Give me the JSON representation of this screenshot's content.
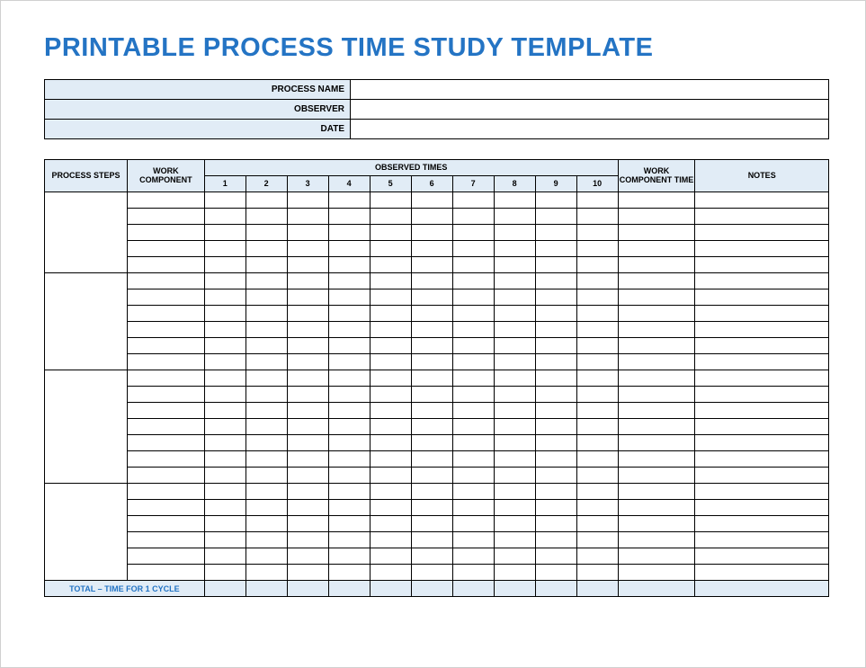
{
  "title": "PRINTABLE PROCESS TIME STUDY TEMPLATE",
  "info": {
    "process_name_label": "PROCESS NAME",
    "process_name_value": "",
    "observer_label": "OBSERVER",
    "observer_value": "",
    "date_label": "DATE",
    "date_value": ""
  },
  "columns": {
    "steps": "PROCESS STEPS",
    "work_component": "WORK COMPONENT",
    "observed_times": "OBSERVED TIMES",
    "obs": [
      "1",
      "2",
      "3",
      "4",
      "5",
      "6",
      "7",
      "8",
      "9",
      "10"
    ],
    "work_component_time": "WORK COMPONENT TIME",
    "notes": "NOTES"
  },
  "groups": [
    {
      "step": "",
      "rows": [
        {
          "comp": "",
          "obs": [
            "",
            "",
            "",
            "",
            "",
            "",
            "",
            "",
            "",
            ""
          ],
          "wct": "",
          "notes": ""
        },
        {
          "comp": "",
          "obs": [
            "",
            "",
            "",
            "",
            "",
            "",
            "",
            "",
            "",
            ""
          ],
          "wct": "",
          "notes": ""
        },
        {
          "comp": "",
          "obs": [
            "",
            "",
            "",
            "",
            "",
            "",
            "",
            "",
            "",
            ""
          ],
          "wct": "",
          "notes": ""
        },
        {
          "comp": "",
          "obs": [
            "",
            "",
            "",
            "",
            "",
            "",
            "",
            "",
            "",
            ""
          ],
          "wct": "",
          "notes": ""
        },
        {
          "comp": "",
          "obs": [
            "",
            "",
            "",
            "",
            "",
            "",
            "",
            "",
            "",
            ""
          ],
          "wct": "",
          "notes": ""
        }
      ]
    },
    {
      "step": "",
      "rows": [
        {
          "comp": "",
          "obs": [
            "",
            "",
            "",
            "",
            "",
            "",
            "",
            "",
            "",
            ""
          ],
          "wct": "",
          "notes": ""
        },
        {
          "comp": "",
          "obs": [
            "",
            "",
            "",
            "",
            "",
            "",
            "",
            "",
            "",
            ""
          ],
          "wct": "",
          "notes": ""
        },
        {
          "comp": "",
          "obs": [
            "",
            "",
            "",
            "",
            "",
            "",
            "",
            "",
            "",
            ""
          ],
          "wct": "",
          "notes": ""
        },
        {
          "comp": "",
          "obs": [
            "",
            "",
            "",
            "",
            "",
            "",
            "",
            "",
            "",
            ""
          ],
          "wct": "",
          "notes": ""
        },
        {
          "comp": "",
          "obs": [
            "",
            "",
            "",
            "",
            "",
            "",
            "",
            "",
            "",
            ""
          ],
          "wct": "",
          "notes": ""
        },
        {
          "comp": "",
          "obs": [
            "",
            "",
            "",
            "",
            "",
            "",
            "",
            "",
            "",
            ""
          ],
          "wct": "",
          "notes": ""
        }
      ]
    },
    {
      "step": "",
      "rows": [
        {
          "comp": "",
          "obs": [
            "",
            "",
            "",
            "",
            "",
            "",
            "",
            "",
            "",
            ""
          ],
          "wct": "",
          "notes": ""
        },
        {
          "comp": "",
          "obs": [
            "",
            "",
            "",
            "",
            "",
            "",
            "",
            "",
            "",
            ""
          ],
          "wct": "",
          "notes": ""
        },
        {
          "comp": "",
          "obs": [
            "",
            "",
            "",
            "",
            "",
            "",
            "",
            "",
            "",
            ""
          ],
          "wct": "",
          "notes": ""
        },
        {
          "comp": "",
          "obs": [
            "",
            "",
            "",
            "",
            "",
            "",
            "",
            "",
            "",
            ""
          ],
          "wct": "",
          "notes": ""
        },
        {
          "comp": "",
          "obs": [
            "",
            "",
            "",
            "",
            "",
            "",
            "",
            "",
            "",
            ""
          ],
          "wct": "",
          "notes": ""
        },
        {
          "comp": "",
          "obs": [
            "",
            "",
            "",
            "",
            "",
            "",
            "",
            "",
            "",
            ""
          ],
          "wct": "",
          "notes": ""
        },
        {
          "comp": "",
          "obs": [
            "",
            "",
            "",
            "",
            "",
            "",
            "",
            "",
            "",
            ""
          ],
          "wct": "",
          "notes": ""
        }
      ]
    },
    {
      "step": "",
      "rows": [
        {
          "comp": "",
          "obs": [
            "",
            "",
            "",
            "",
            "",
            "",
            "",
            "",
            "",
            ""
          ],
          "wct": "",
          "notes": ""
        },
        {
          "comp": "",
          "obs": [
            "",
            "",
            "",
            "",
            "",
            "",
            "",
            "",
            "",
            ""
          ],
          "wct": "",
          "notes": ""
        },
        {
          "comp": "",
          "obs": [
            "",
            "",
            "",
            "",
            "",
            "",
            "",
            "",
            "",
            ""
          ],
          "wct": "",
          "notes": ""
        },
        {
          "comp": "",
          "obs": [
            "",
            "",
            "",
            "",
            "",
            "",
            "",
            "",
            "",
            ""
          ],
          "wct": "",
          "notes": ""
        },
        {
          "comp": "",
          "obs": [
            "",
            "",
            "",
            "",
            "",
            "",
            "",
            "",
            "",
            ""
          ],
          "wct": "",
          "notes": ""
        },
        {
          "comp": "",
          "obs": [
            "",
            "",
            "",
            "",
            "",
            "",
            "",
            "",
            "",
            ""
          ],
          "wct": "",
          "notes": ""
        }
      ]
    }
  ],
  "total": {
    "label": "TOTAL – TIME FOR 1 CYCLE",
    "obs": [
      "",
      "",
      "",
      "",
      "",
      "",
      "",
      "",
      "",
      ""
    ],
    "wct": "",
    "notes": ""
  }
}
